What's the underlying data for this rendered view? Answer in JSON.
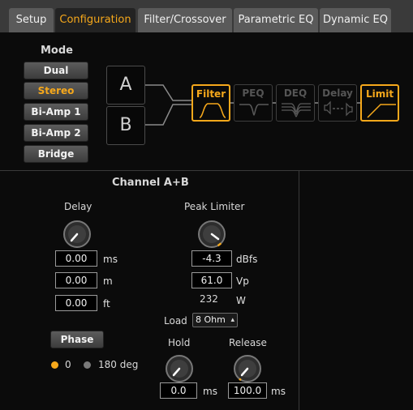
{
  "tabs": [
    {
      "label": "Setup",
      "active": false
    },
    {
      "label": "Configuration",
      "active": true
    },
    {
      "label": "Filter/Crossover",
      "active": false
    },
    {
      "label": "Parametric EQ",
      "active": false
    },
    {
      "label": "Dynamic EQ",
      "active": false
    }
  ],
  "mode": {
    "title": "Mode",
    "options": [
      "Dual",
      "Stereo",
      "Bi-Amp 1",
      "Bi-Amp 2",
      "Bridge"
    ],
    "selected": "Stereo"
  },
  "signal_chain": {
    "inputs": [
      "A",
      "B"
    ],
    "blocks": [
      {
        "label": "Filter",
        "enabled": true
      },
      {
        "label": "PEQ",
        "enabled": false
      },
      {
        "label": "DEQ",
        "enabled": false
      },
      {
        "label": "Delay",
        "enabled": false
      },
      {
        "label": "Limit",
        "enabled": true
      }
    ]
  },
  "channel": {
    "title": "Channel A+B",
    "delay": {
      "title": "Delay",
      "ms_value": "0.00",
      "ms_unit": "ms",
      "m_value": "0.00",
      "m_unit": "m",
      "ft_value": "0.00",
      "ft_unit": "ft"
    },
    "limiter": {
      "title": "Peak Limiter",
      "dbfs_value": "-4.3",
      "dbfs_unit": "dBfs",
      "vp_value": "61.0",
      "vp_unit": "Vp",
      "w_value": "232",
      "w_unit": "W",
      "load_label": "Load",
      "load_value": "8 Ohm"
    },
    "phase": {
      "button_label": "Phase",
      "option_0": "0",
      "option_180": "180 deg",
      "selected": "0"
    },
    "hold": {
      "title": "Hold",
      "value": "0.0",
      "unit": "ms"
    },
    "release": {
      "title": "Release",
      "value": "100.0",
      "unit": "ms"
    }
  },
  "colors": {
    "accent": "#f6a81b",
    "panel": "#0b0b0b",
    "tab": "#5a5a5a"
  }
}
